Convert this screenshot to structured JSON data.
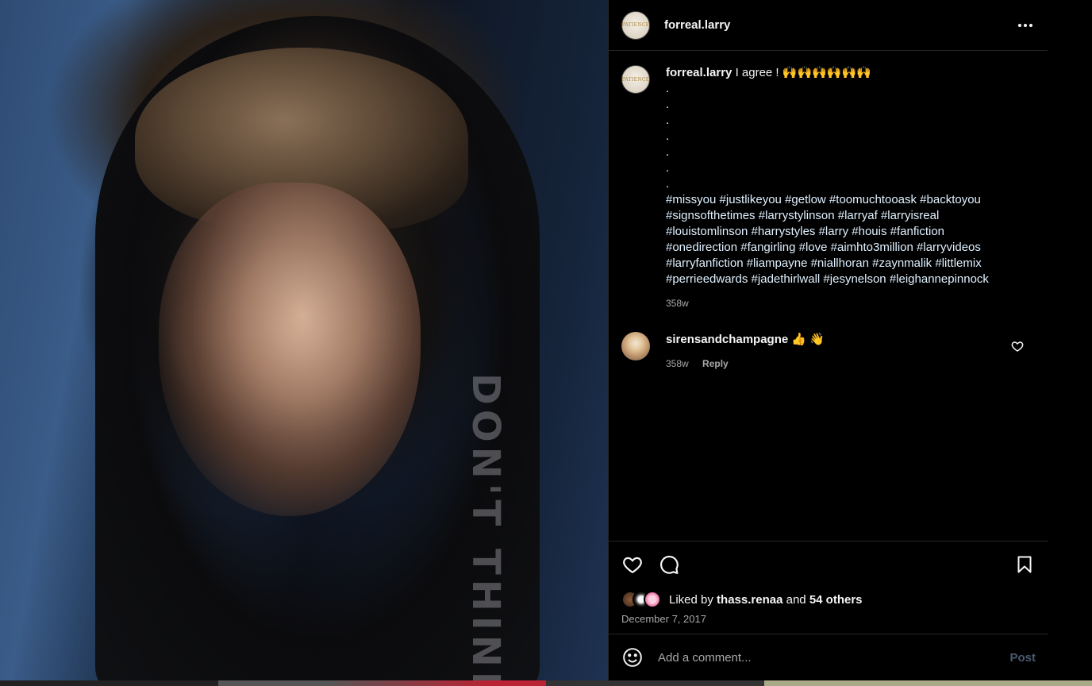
{
  "post": {
    "username": "forreal.larry",
    "avatar_text": "PATIENCE"
  },
  "caption": {
    "username": "forreal.larry",
    "text": "I agree ! 🙌🙌🙌🙌🙌🙌",
    "dots": [
      ".",
      ".",
      ".",
      ".",
      ".",
      ".",
      "."
    ],
    "hashtags": "#missyou #justlikeyou #getlow #toomuchtooask #backtoyou #signsofthetimes #larrystylinson #larryaf #larryisreal #louistomlinson #harrystyles #larry #houis #fanfiction #onedirection #fangirling #love #aimhto3million #larryvideos #larryfanfiction #liampayne #niallhoran #zaynmalik #littlemix #perrieedwards #jadethirlwall #jesynelson #leighannepinnock",
    "time": "358w"
  },
  "comments": [
    {
      "username": "sirensandchampagne",
      "text": "👍 👋",
      "time": "358w",
      "reply_label": "Reply"
    }
  ],
  "photo": {
    "hoodie_text": "DON'T THINK"
  },
  "likes": {
    "prefix": "Liked by",
    "user": "thass.renaa",
    "and": "and",
    "others": "54 others"
  },
  "date": "December 7, 2017",
  "add_comment": {
    "placeholder": "Add a comment...",
    "post_label": "Post"
  },
  "icons": {
    "more": "more-options-icon",
    "like": "heart-icon",
    "comment": "comment-icon",
    "save": "bookmark-icon",
    "emoji": "emoji-icon"
  }
}
